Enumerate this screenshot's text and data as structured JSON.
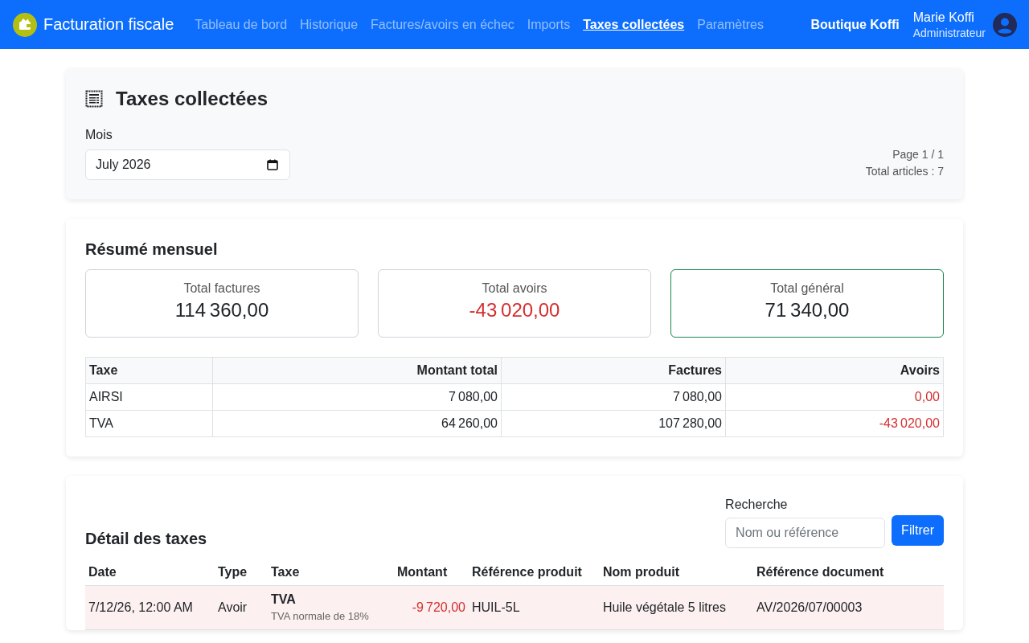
{
  "navbar": {
    "brand": "Facturation fiscale",
    "links": [
      {
        "label": "Tableau de bord",
        "selected": false
      },
      {
        "label": "Historique",
        "selected": false
      },
      {
        "label": "Factures/avoirs en échec",
        "selected": false
      },
      {
        "label": "Imports",
        "selected": false
      },
      {
        "label": "Taxes collectées",
        "selected": true
      },
      {
        "label": "Paramètres",
        "selected": false
      }
    ],
    "shop": "Boutique Koffi",
    "user": {
      "name": "Marie Koffi",
      "role": "Administrateur"
    }
  },
  "header_card": {
    "title": "Taxes collectées",
    "month_label": "Mois",
    "month_value": "July 2026",
    "page_info": "Page 1 / 1",
    "total_items": "Total articles : 7"
  },
  "summary": {
    "title": "Résumé mensuel",
    "cards": [
      {
        "label": "Total factures",
        "value": "114 360,00",
        "kind": "invoices"
      },
      {
        "label": "Total avoirs",
        "value": "-43 020,00",
        "kind": "credits"
      },
      {
        "label": "Total général",
        "value": "71 340,00",
        "kind": "total"
      }
    ],
    "table": {
      "columns": [
        {
          "label": "Taxe",
          "kind": "text"
        },
        {
          "label": "Montant total",
          "kind": "amount"
        },
        {
          "label": "Factures",
          "kind": "amount"
        },
        {
          "label": "Avoirs",
          "kind": "credit"
        }
      ],
      "rows": [
        [
          "AIRSI",
          "7 080,00",
          "7 080,00",
          "0,00"
        ],
        [
          "TVA",
          "64 260,00",
          "107 280,00",
          "-43 020,00"
        ]
      ]
    }
  },
  "detail": {
    "title": "Détail des taxes",
    "search": {
      "label": "Recherche",
      "placeholder": "Nom ou référence"
    },
    "filter_button": "Filtrer",
    "columns": [
      "Date",
      "Type",
      "Taxe",
      "Montant",
      "Référence produit",
      "Nom produit",
      "Référence document"
    ],
    "rows": [
      {
        "kind": "credit",
        "date": "7/12/26, 12:00 AM",
        "type": "Avoir",
        "tax": "TVA",
        "tax_note": "TVA normale de 18%",
        "amount": "-9 720,00",
        "product_ref": "HUIL-5L",
        "product_name": "Huile végétale 5 litres",
        "document_ref": "AV/2026/07/00003"
      }
    ]
  }
}
